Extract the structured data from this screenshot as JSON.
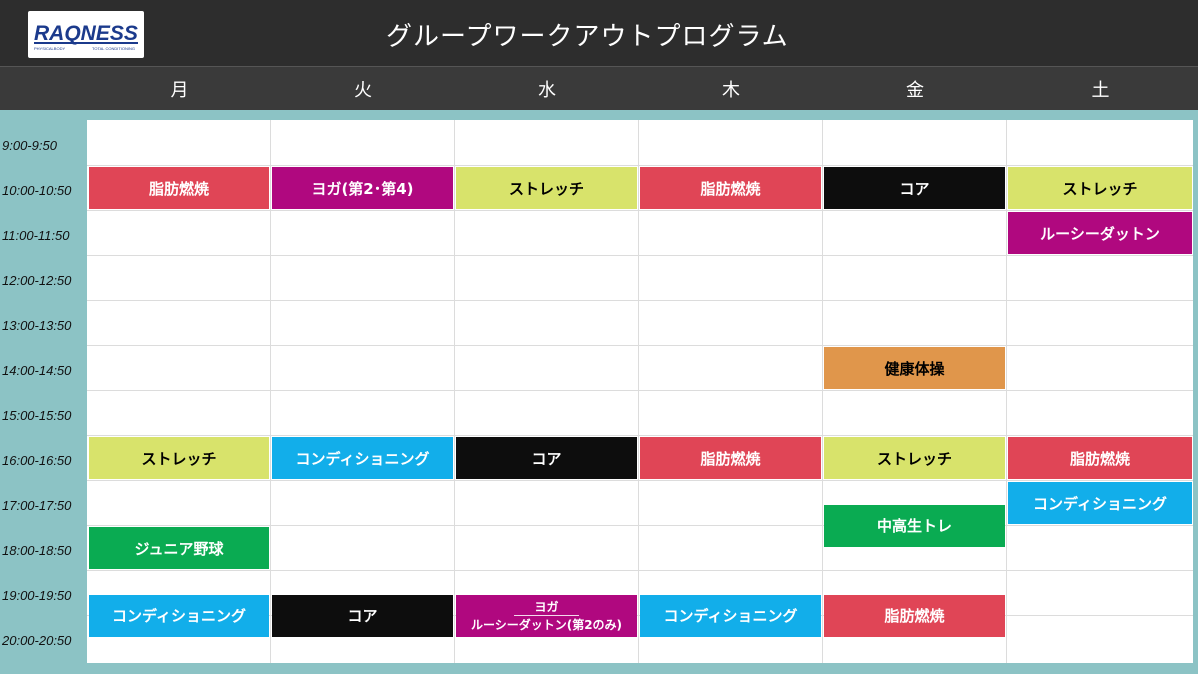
{
  "app": {
    "title": "グループワークアウトプログラム",
    "logo_text": "RAQNESS",
    "logo_tagline_left": "PHYSICALBODY",
    "logo_tagline_right": "TOTAL CONDITIONING"
  },
  "days": [
    "月",
    "火",
    "水",
    "木",
    "金",
    "土"
  ],
  "times": [
    "9:00-9:50",
    "10:00-10:50",
    "11:00-11:50",
    "12:00-12:50",
    "13:00-13:50",
    "14:00-14:50",
    "15:00-15:50",
    "16:00-16:50",
    "17:00-17:50",
    "18:00-18:50",
    "19:00-19:50",
    "20:00-20:50"
  ],
  "program_types": {
    "fat_burn": {
      "label": "脂肪燃焼",
      "bg": "#e04556",
      "fg": "#ffffff"
    },
    "stretch": {
      "label": "ストレッチ",
      "bg": "#d8e36b",
      "fg": "#000000"
    },
    "core": {
      "label": "コア",
      "bg": "#0d0d0d",
      "fg": "#ffffff"
    },
    "conditioning": {
      "label": "コンディショニング",
      "bg": "#12aeea",
      "fg": "#ffffff"
    },
    "yoga": {
      "label": "ヨガ",
      "bg": "#b0087f",
      "fg": "#ffffff"
    },
    "ruth_dutton": {
      "label": "ルーシーダットン",
      "bg": "#b0087f",
      "fg": "#ffffff"
    },
    "health_gym": {
      "label": "健康体操",
      "bg": "#e0964b",
      "fg": "#000000"
    },
    "junior": {
      "label": "ジュニア野球",
      "bg": "#0aab52",
      "fg": "#ffffff"
    },
    "teens": {
      "label": "中高生トレ",
      "bg": "#0aab52",
      "fg": "#ffffff"
    }
  },
  "classes": [
    {
      "day": 0,
      "time_slot": 1,
      "type": "fat_burn"
    },
    {
      "day": 1,
      "time_slot": 1,
      "type": "yoga",
      "label": "ヨガ(第2･第4)"
    },
    {
      "day": 2,
      "time_slot": 1,
      "type": "stretch"
    },
    {
      "day": 3,
      "time_slot": 1,
      "type": "fat_burn"
    },
    {
      "day": 4,
      "time_slot": 1,
      "type": "core"
    },
    {
      "day": 5,
      "time_slot": 1,
      "type": "stretch"
    },
    {
      "day": 5,
      "time_slot": 2,
      "type": "ruth_dutton"
    },
    {
      "day": 4,
      "time_slot": 5,
      "type": "health_gym"
    },
    {
      "day": 0,
      "time_slot": 7,
      "type": "stretch"
    },
    {
      "day": 1,
      "time_slot": 7,
      "type": "conditioning"
    },
    {
      "day": 2,
      "time_slot": 7,
      "type": "core"
    },
    {
      "day": 3,
      "time_slot": 7,
      "type": "fat_burn"
    },
    {
      "day": 4,
      "time_slot": 7,
      "type": "stretch"
    },
    {
      "day": 5,
      "time_slot": 7,
      "type": "fat_burn"
    },
    {
      "day": 5,
      "time_slot": 8,
      "type": "conditioning"
    },
    {
      "day": 4,
      "time_slot": 8.5,
      "type": "teens"
    },
    {
      "day": 0,
      "time_slot": 9,
      "type": "junior"
    },
    {
      "day": 0,
      "time_slot": 10.5,
      "type": "conditioning"
    },
    {
      "day": 1,
      "time_slot": 10.5,
      "type": "core"
    },
    {
      "day": 2,
      "time_slot": 10.5,
      "type": "yoga",
      "label": "ヨガ",
      "label2": "ルーシーダットン(第2のみ)"
    },
    {
      "day": 3,
      "time_slot": 10.5,
      "type": "conditioning"
    },
    {
      "day": 4,
      "time_slot": 10.5,
      "type": "fat_burn"
    }
  ]
}
